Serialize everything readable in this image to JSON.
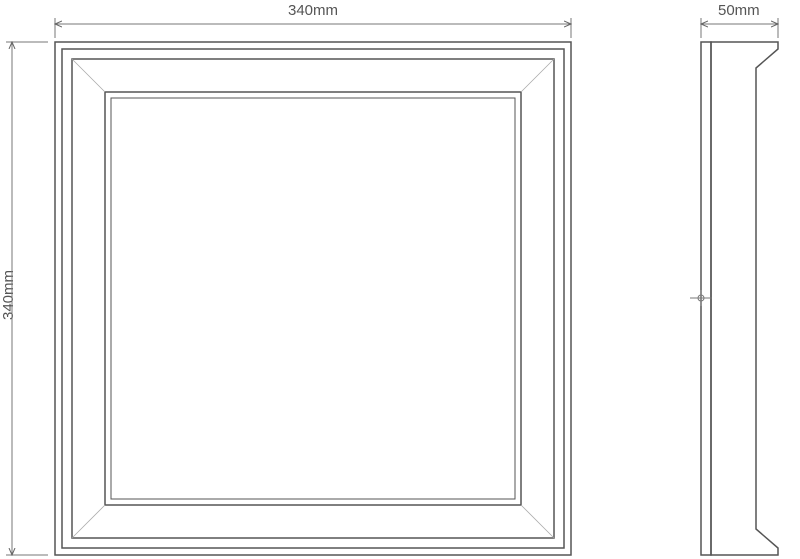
{
  "dimensions": {
    "width_label": "340mm",
    "height_label": "340mm",
    "depth_label": "50mm"
  }
}
